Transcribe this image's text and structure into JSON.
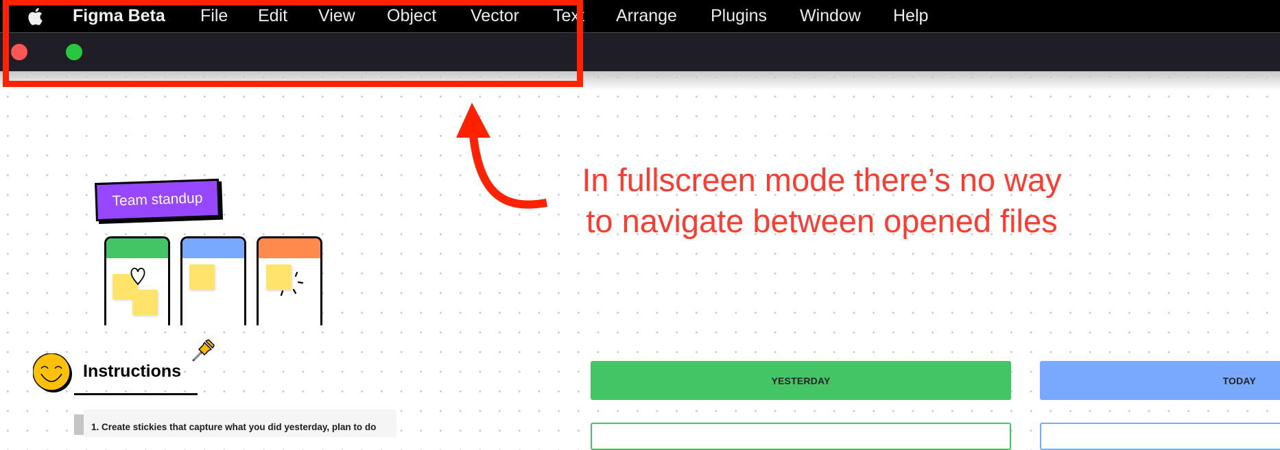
{
  "menubar": {
    "apple_icon": "apple-logo-icon",
    "app_name": "Figma Beta",
    "items": [
      "File",
      "Edit",
      "View",
      "Object",
      "Vector",
      "Text",
      "Arrange",
      "Plugins",
      "Window",
      "Help"
    ]
  },
  "window": {
    "traffic_lights": [
      {
        "name": "close",
        "color": "#fd5755"
      },
      {
        "name": "fullscreen",
        "color": "#28c73f"
      }
    ]
  },
  "annotation": {
    "highlight_color": "#ff2200",
    "text_line1": "In fullscreen mode there’s no way",
    "text_line2": "to navigate between opened files",
    "text_color": "#ff3b30"
  },
  "canvas": {
    "standup": {
      "tag_label": "Team standup",
      "tag_color": "#9747ff",
      "columns": [
        {
          "color": "#44c565",
          "decoration": "heart-icon"
        },
        {
          "color": "#79a9ff",
          "decoration": ""
        },
        {
          "color": "#ff8a4c",
          "decoration": "sparkle-icon"
        }
      ]
    },
    "instructions": {
      "title": "Instructions",
      "step1": "1.  Create stickies that capture what you did yesterday, plan to do"
    },
    "board": {
      "columns": [
        {
          "label": "YESTERDAY",
          "color": "#44c565"
        },
        {
          "label": "TODAY",
          "color": "#79a9ff"
        }
      ]
    }
  }
}
